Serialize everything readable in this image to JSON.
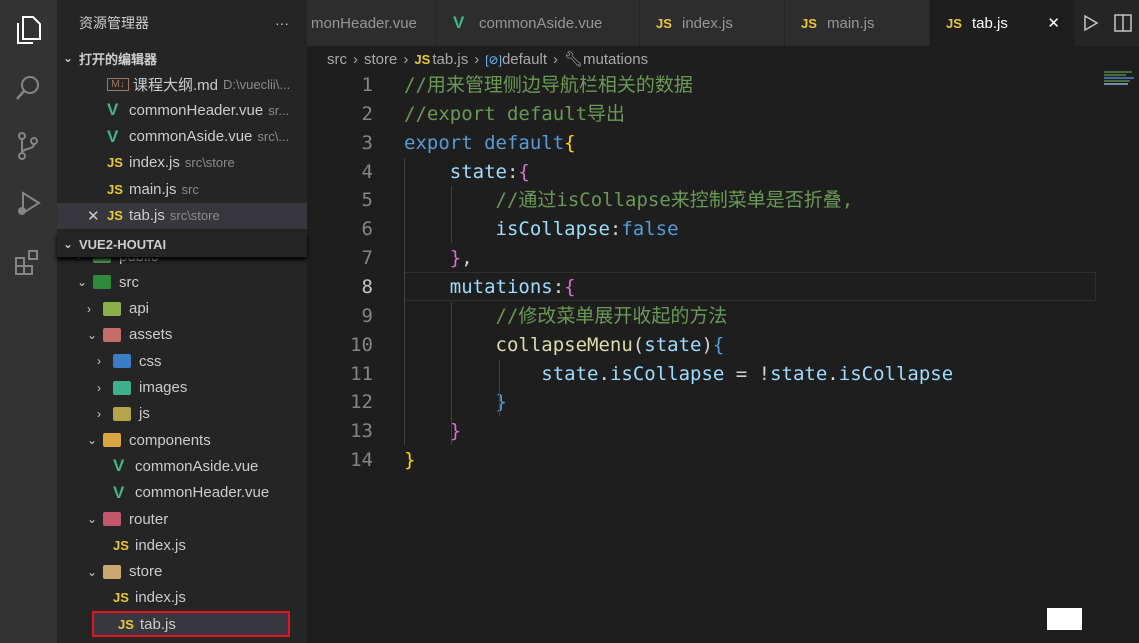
{
  "sidebar": {
    "title": "资源管理器",
    "more": "···",
    "open_editors_title": "打开的编辑器",
    "open_editors": [
      {
        "icon": "markdown-icon",
        "name": "课程大纲.md",
        "desc": "D:\\vueclii\\..."
      },
      {
        "icon": "vue-icon",
        "name": "commonHeader.vue",
        "desc": "sr..."
      },
      {
        "icon": "vue-icon",
        "name": "commonAside.vue",
        "desc": "src\\..."
      },
      {
        "icon": "js-icon",
        "name": "index.js",
        "desc": "src\\store"
      },
      {
        "icon": "js-icon",
        "name": "main.js",
        "desc": "src"
      },
      {
        "icon": "js-icon",
        "name": "tab.js",
        "desc": "src\\store",
        "active": true
      }
    ],
    "project_title": "VUE2-HOUTAI",
    "tree": [
      {
        "name": "public",
        "depth": 0,
        "type": "folder",
        "color": "#5a9e5a",
        "chev": "›"
      },
      {
        "name": "src",
        "depth": 0,
        "type": "folder",
        "color": "#2e8b3c",
        "chev": "⌄"
      },
      {
        "name": "api",
        "depth": 1,
        "type": "folder",
        "color": "#8bb04a",
        "chev": "›"
      },
      {
        "name": "assets",
        "depth": 1,
        "type": "folder",
        "color": "#c76b6b",
        "chev": "⌄"
      },
      {
        "name": "css",
        "depth": 2,
        "type": "folder",
        "color": "#3b7dc4",
        "chev": "›"
      },
      {
        "name": "images",
        "depth": 2,
        "type": "folder",
        "color": "#3fae8c",
        "chev": "›"
      },
      {
        "name": "js",
        "depth": 2,
        "type": "folder",
        "color": "#b3a54a",
        "chev": "›"
      },
      {
        "name": "components",
        "depth": 1,
        "type": "folder",
        "color": "#d9a441",
        "chev": "⌄"
      },
      {
        "name": "commonAside.vue",
        "depth": 2,
        "type": "vue"
      },
      {
        "name": "commonHeader.vue",
        "depth": 2,
        "type": "vue"
      },
      {
        "name": "router",
        "depth": 1,
        "type": "folder",
        "color": "#c2566b",
        "chev": "⌄"
      },
      {
        "name": "index.js",
        "depth": 2,
        "type": "js"
      },
      {
        "name": "store",
        "depth": 1,
        "type": "folder",
        "color": "#c9a874",
        "chev": "⌄"
      },
      {
        "name": "index.js",
        "depth": 2,
        "type": "js"
      },
      {
        "name": "tab.js",
        "depth": 2,
        "type": "js",
        "selected": true
      }
    ]
  },
  "tabs": [
    {
      "label": "monHeader.vue",
      "icon": ""
    },
    {
      "label": "commonAside.vue",
      "icon": "vue-icon"
    },
    {
      "label": "index.js",
      "icon": "js-icon"
    },
    {
      "label": "main.js",
      "icon": "js-icon"
    },
    {
      "label": "tab.js",
      "icon": "js-icon",
      "active": true
    }
  ],
  "js_badge": "JS",
  "vue_badge": "V",
  "md_badge": "M↓",
  "close": "✕",
  "breadcrumb": [
    "src",
    "store",
    "tab.js",
    "default",
    "mutations"
  ],
  "code": {
    "current_line": 8,
    "lines": [
      [
        [
          "c",
          "//用来管理侧边导航栏相关的数据"
        ]
      ],
      [
        [
          "c",
          "//export default导出"
        ]
      ],
      [
        [
          "k",
          "export "
        ],
        [
          "k",
          "default"
        ],
        [
          "b",
          "{"
        ]
      ],
      [
        [
          "o",
          "    "
        ],
        [
          "p",
          "state"
        ],
        [
          "o",
          ":"
        ],
        [
          "m",
          "{"
        ]
      ],
      [
        [
          "o",
          "        "
        ],
        [
          "c",
          "//通过isCollapse来控制菜单是否折叠,"
        ]
      ],
      [
        [
          "o",
          "        "
        ],
        [
          "p",
          "isCollapse"
        ],
        [
          "o",
          ":"
        ],
        [
          "k",
          "false"
        ]
      ],
      [
        [
          "o",
          "    "
        ],
        [
          "m",
          "}"
        ],
        [
          "o",
          ","
        ]
      ],
      [
        [
          "o",
          "    "
        ],
        [
          "p",
          "mutations"
        ],
        [
          "o",
          ":"
        ],
        [
          "m",
          "{"
        ]
      ],
      [
        [
          "o",
          "        "
        ],
        [
          "c",
          "//修改菜单展开收起的方法"
        ]
      ],
      [
        [
          "o",
          "        "
        ],
        [
          "f",
          "collapseMenu"
        ],
        [
          "o",
          "("
        ],
        [
          "p",
          "state"
        ],
        [
          "o",
          ")"
        ],
        [
          "k",
          "{"
        ]
      ],
      [
        [
          "o",
          "            "
        ],
        [
          "p",
          "state"
        ],
        [
          "o",
          "."
        ],
        [
          "p",
          "isCollapse"
        ],
        [
          "o",
          " = !"
        ],
        [
          "p",
          "state"
        ],
        [
          "o",
          "."
        ],
        [
          "p",
          "isCollapse"
        ]
      ],
      [
        [
          "o",
          "        "
        ],
        [
          "k",
          "}"
        ]
      ],
      [
        [
          "o",
          "    "
        ],
        [
          "m",
          "}"
        ]
      ],
      [
        [
          "b",
          "}"
        ]
      ]
    ]
  },
  "colors": {
    "highlight_box": "#e81123",
    "vue": "#41b883",
    "js": "#e8c93a"
  }
}
